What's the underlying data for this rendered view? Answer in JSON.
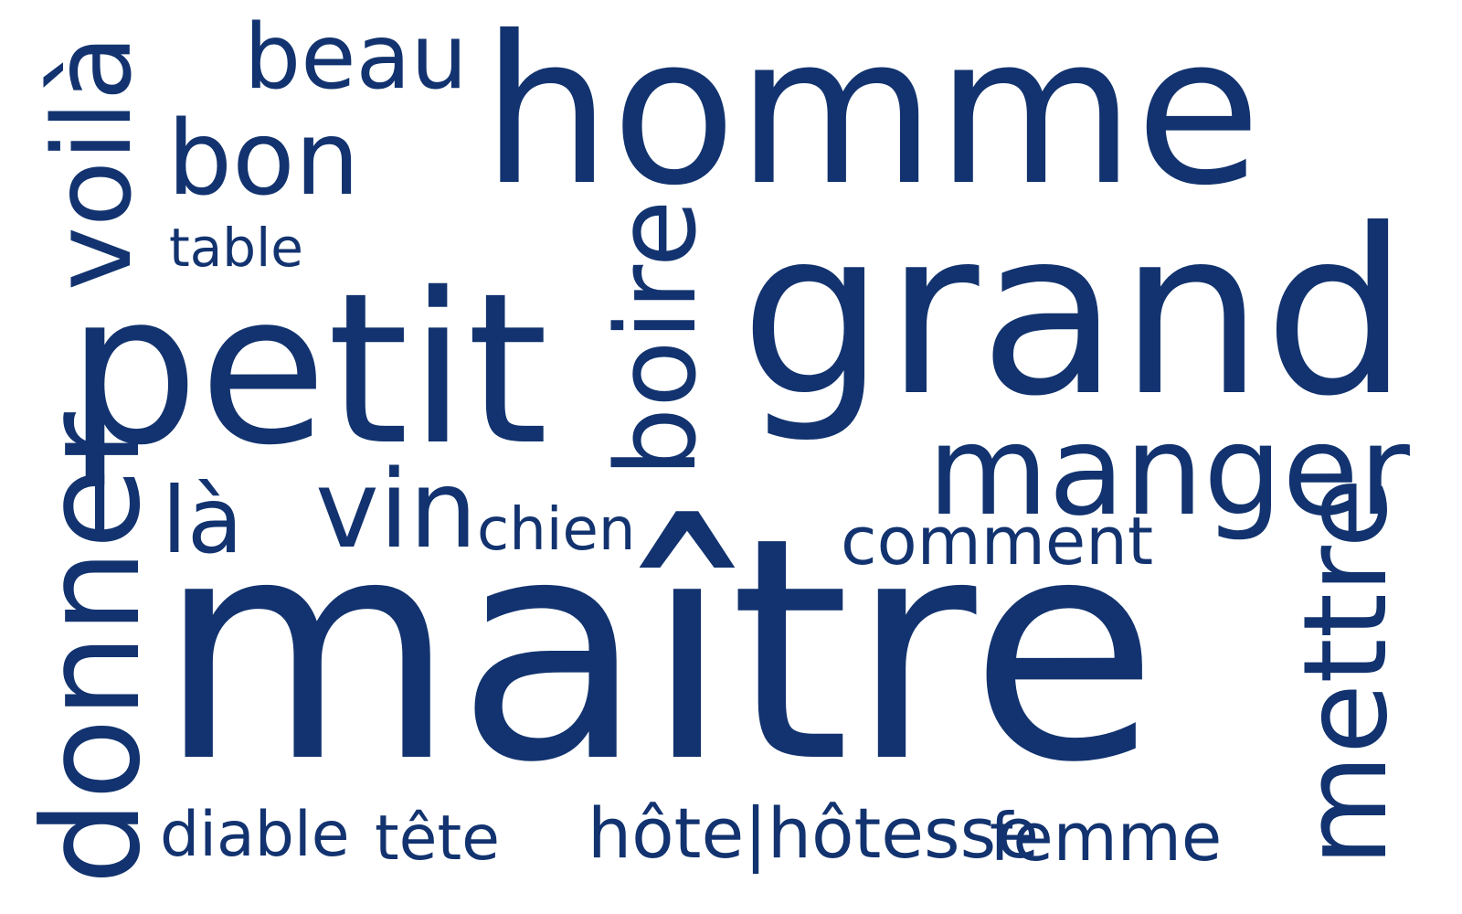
{
  "word_cloud": {
    "color": "#12336f",
    "background": "#ffffff",
    "words": [
      {
        "key": "homme",
        "text": "homme",
        "orientation": "horizontal"
      },
      {
        "key": "beau",
        "text": "beau",
        "orientation": "horizontal"
      },
      {
        "key": "bon",
        "text": "bon",
        "orientation": "horizontal"
      },
      {
        "key": "table",
        "text": "table",
        "orientation": "horizontal"
      },
      {
        "key": "voila",
        "text": "voilà",
        "orientation": "vertical"
      },
      {
        "key": "petit",
        "text": "petit",
        "orientation": "horizontal"
      },
      {
        "key": "boire",
        "text": "boire",
        "orientation": "vertical"
      },
      {
        "key": "grand",
        "text": "grand",
        "orientation": "horizontal"
      },
      {
        "key": "manger",
        "text": "manger",
        "orientation": "horizontal"
      },
      {
        "key": "la",
        "text": "là",
        "orientation": "horizontal"
      },
      {
        "key": "vin",
        "text": "vin",
        "orientation": "horizontal"
      },
      {
        "key": "chien",
        "text": "chien",
        "orientation": "horizontal"
      },
      {
        "key": "comment",
        "text": "comment",
        "orientation": "horizontal"
      },
      {
        "key": "maitre",
        "text": "maître",
        "orientation": "horizontal"
      },
      {
        "key": "donner",
        "text": "donner",
        "orientation": "vertical"
      },
      {
        "key": "mettre",
        "text": "mettre",
        "orientation": "vertical"
      },
      {
        "key": "diable",
        "text": "diable",
        "orientation": "horizontal"
      },
      {
        "key": "tete",
        "text": "tête",
        "orientation": "horizontal"
      },
      {
        "key": "hote",
        "text": "hôte|hôtesse",
        "orientation": "horizontal"
      },
      {
        "key": "femme",
        "text": "femme",
        "orientation": "horizontal"
      }
    ]
  }
}
